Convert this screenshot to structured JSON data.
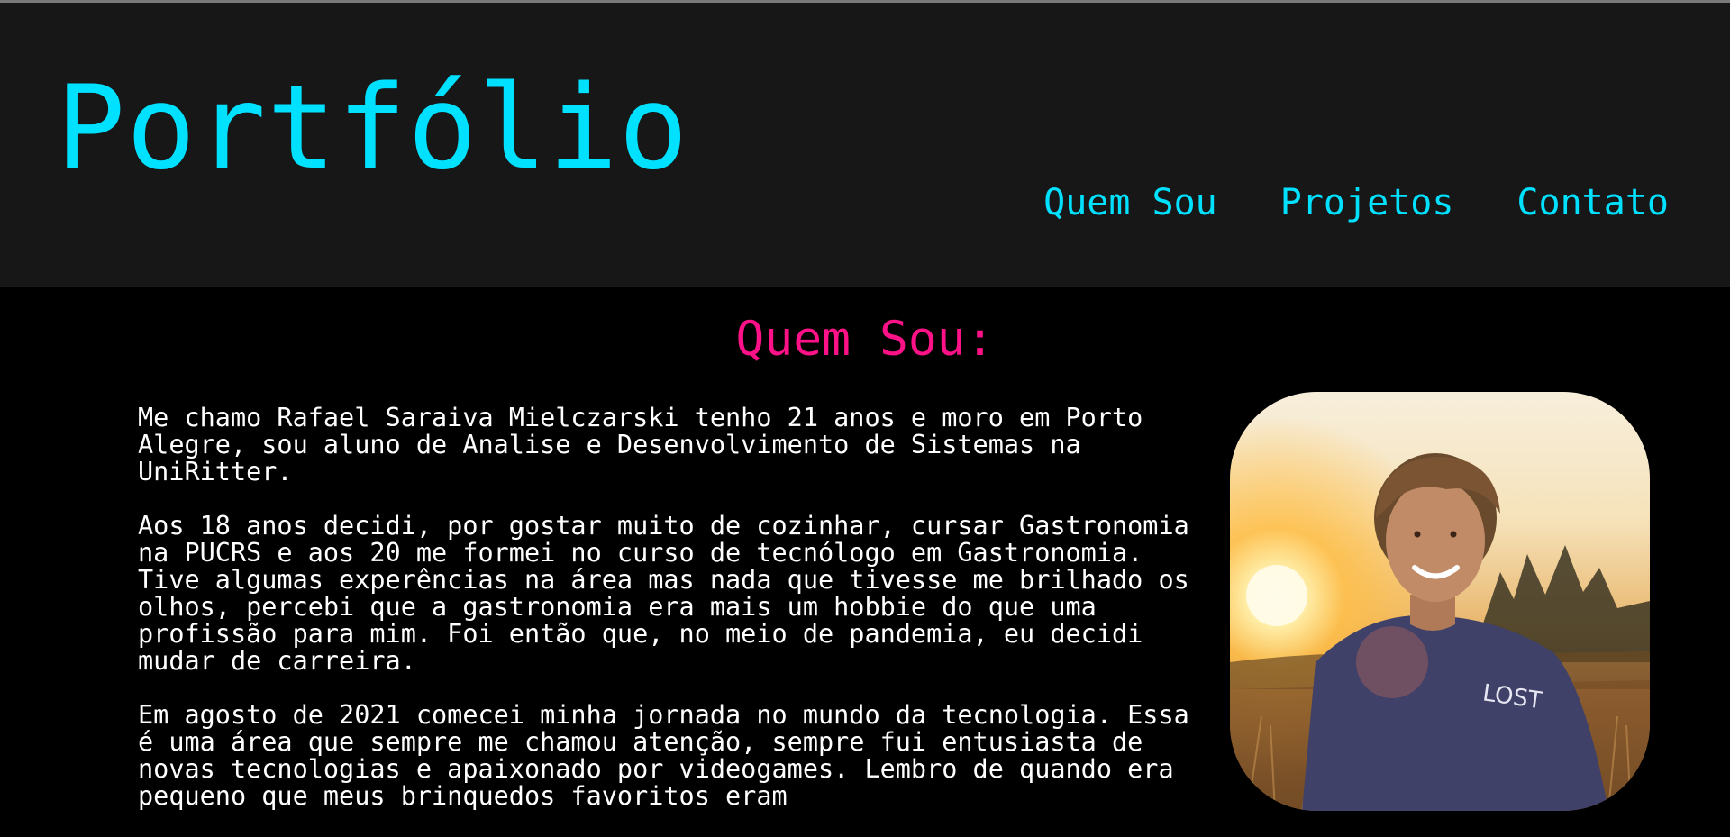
{
  "header": {
    "title": "Portfólio",
    "nav": [
      "Quem Sou",
      "Projetos",
      "Contato"
    ]
  },
  "about": {
    "heading": "Quem Sou:",
    "paragraphs": [
      "Me chamo Rafael Saraiva Mielczarski tenho 21 anos e moro em Porto Alegre, sou aluno de Analise e Desenvolvimento de Sistemas na UniRitter.",
      "Aos 18 anos decidi, por gostar muito de cozinhar, cursar Gastronomia na PUCRS e aos 20 me formei no curso de tecnólogo em Gastronomia. Tive algumas experências na área mas nada que tivesse me brilhado os olhos, percebi que a gastronomia era mais um hobbie do que uma profissão para mim. Foi então que, no meio de pandemia, eu decidi mudar de carreira.",
      "Em agosto de 2021 comecei minha jornada no mundo da tecnologia. Essa é uma área que sempre me chamou atenção, sempre fui entusiasta de novas tecnologias e apaixonado por videogames. Lembro de quando era pequeno que meus brinquedos favoritos eram"
    ],
    "photo_shirt_text": "LOST"
  },
  "colors": {
    "accent_cyan": "#00e1ff",
    "accent_pink": "#ff1188",
    "header_bg": "#171717",
    "page_bg": "#000000"
  }
}
